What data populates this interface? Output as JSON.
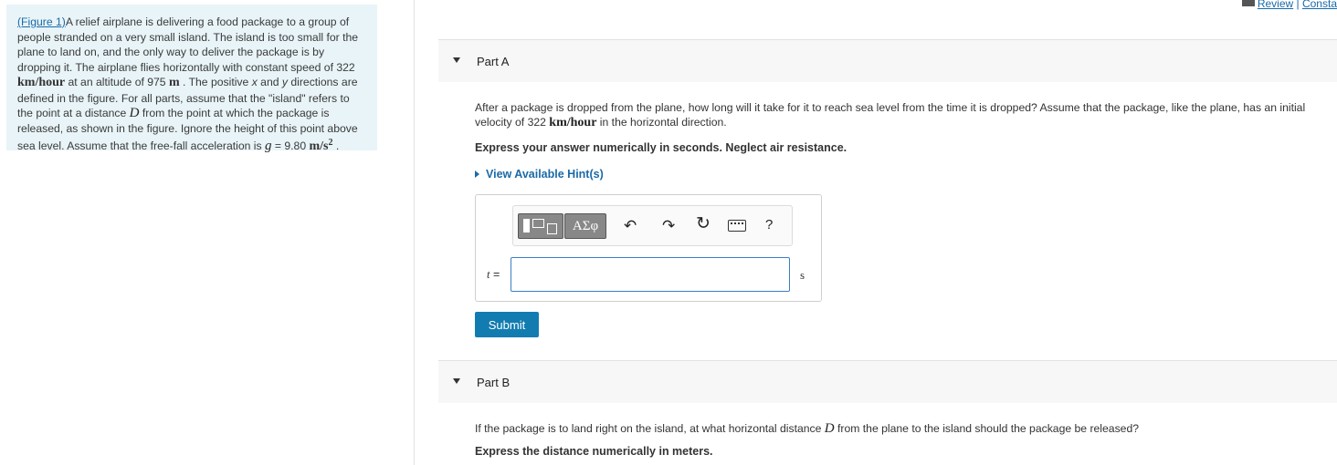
{
  "problem": {
    "figure_link": "(Figure 1)",
    "t1": "A relief airplane is delivering a food package to a group of people stranded on a very small island. The island is too small for the plane to land on, and the only way to deliver the package is by dropping it. The airplane flies horizontally with constant speed of 322 ",
    "u_speed": "km/hour",
    "t2": " at an altitude of 975 ",
    "u_m": "m",
    "t3": " . The positive ",
    "x": "x",
    "and": " and ",
    "y": "y",
    "t4": " directions are defined in the figure. For all parts, assume that the \"island\" refers to the point at a distance ",
    "D": "D",
    "t5": " from the point at which the package is released, as shown in the figure. Ignore the height of this point above sea level. Assume that the free-fall acceleration is ",
    "g": "g",
    "t6": " = 9.80 ",
    "u_acc": "m/s",
    "sup": "2",
    "t7": " ."
  },
  "toplinks": {
    "review": "Review",
    "sep": " | ",
    "constants": "Consta"
  },
  "partA": {
    "label": "Part A",
    "q1": "After a package is dropped from the plane, how long will it take for it to reach sea level from the time it is dropped? Assume that the package, like the plane, has an initial velocity of 322 ",
    "q_unit": "km/hour",
    "q2": " in the horizontal direction.",
    "instruction": "Express your answer numerically in seconds. Neglect air resistance.",
    "hint": "View Available Hint(s)",
    "greek": "ΑΣφ",
    "undo": "↶",
    "redo": "↷",
    "reset": "↻",
    "help": "?",
    "var": "t",
    "eq": " =",
    "input_value": "",
    "unit": "s",
    "submit": "Submit"
  },
  "partB": {
    "label": "Part B",
    "q1": "If the package is to land right on the island, at what horizontal distance ",
    "D": "D",
    "q2": " from the plane to the island should the package be released?",
    "instruction": "Express the distance numerically in meters."
  }
}
